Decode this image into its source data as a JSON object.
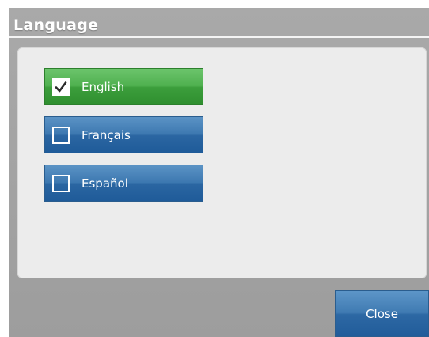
{
  "dialog": {
    "title": "Language"
  },
  "languages": [
    {
      "label": "English",
      "checked": true,
      "color": "#4fb04f"
    },
    {
      "label": "Français",
      "checked": false,
      "color": "#2f6ba6"
    },
    {
      "label": "Español",
      "checked": false,
      "color": "#2f6ba6"
    }
  ],
  "footer": {
    "close_label": "Close"
  }
}
